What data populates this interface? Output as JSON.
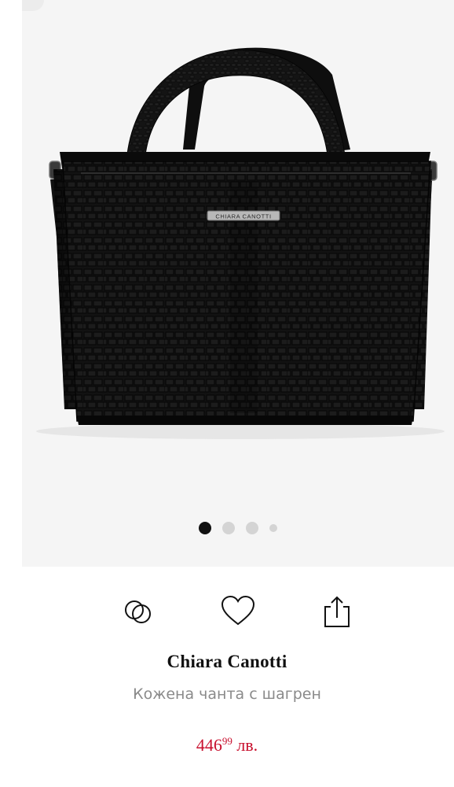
{
  "gallery": {
    "image_label": "black croc-embossed leather handbag",
    "plate_text": "CHIARA CANOTTI",
    "dots": [
      {
        "active": true
      },
      {
        "active": false
      },
      {
        "active": false
      },
      {
        "active": false,
        "small": true
      }
    ]
  },
  "actions": [
    {
      "name": "compare-icon"
    },
    {
      "name": "heart-icon"
    },
    {
      "name": "share-icon"
    }
  ],
  "product": {
    "brand": "Chiara Canotti",
    "title": "Кожена чанта с шагрен",
    "price_main": "446",
    "price_cents": "99",
    "currency": "лв."
  },
  "colors": {
    "price": "#c8102e",
    "gallery_bg": "#f5f5f5",
    "dot_active": "#111111",
    "dot_inactive": "#d4d4d4"
  }
}
